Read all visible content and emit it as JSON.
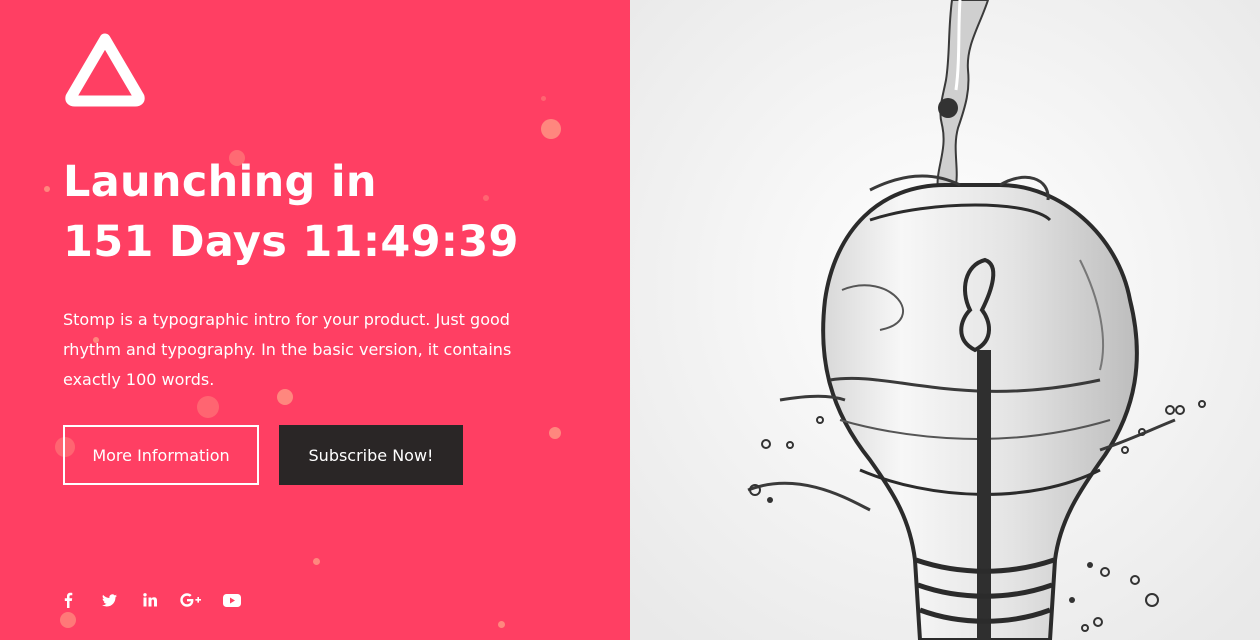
{
  "colors": {
    "accent": "#ff3f63",
    "dark_button": "#2a2626",
    "dot": "#ffa087"
  },
  "hero": {
    "title_line1": "Launching in",
    "title_line2": "151 Days 11:49:39",
    "description": "Stomp is a typographic intro for your product. Just good rhythm and typography. In the basic version, it contains exactly 100 words."
  },
  "buttons": {
    "more_info": "More Information",
    "subscribe": "Subscribe Now!"
  },
  "social": [
    "facebook-icon",
    "twitter-icon",
    "linkedin-icon",
    "google-plus-icon",
    "youtube-icon"
  ]
}
